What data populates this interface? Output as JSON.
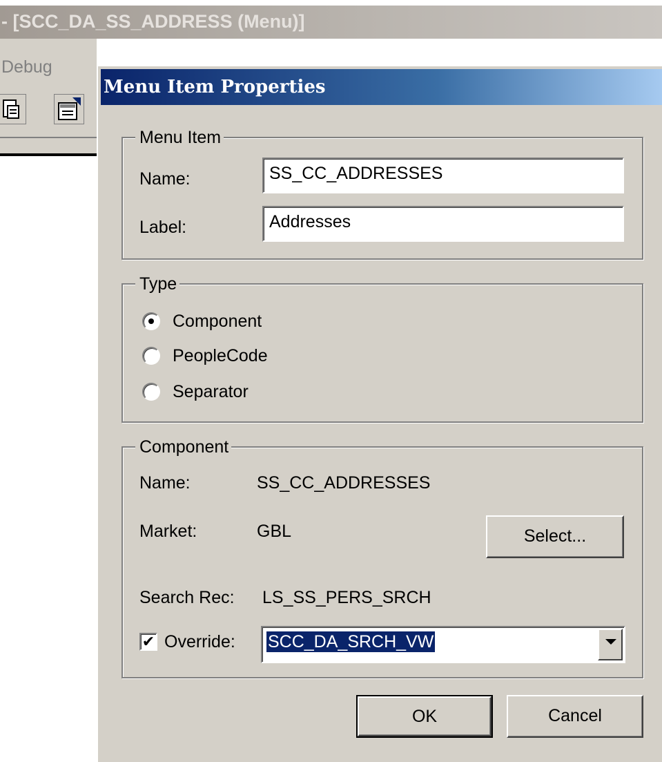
{
  "app": {
    "window_title": "- [SCC_DA_SS_ADDRESS (Menu)]",
    "menu_visible": "Debug"
  },
  "dialog": {
    "title": "Menu Item Properties",
    "menu_item": {
      "legend": "Menu Item",
      "name_label": "Name:",
      "name_value": "SS_CC_ADDRESSES",
      "label_label": "Label:",
      "label_value": "Addresses"
    },
    "type": {
      "legend": "Type",
      "options": [
        {
          "label": "Component",
          "checked": true
        },
        {
          "label": "PeopleCode",
          "checked": false
        },
        {
          "label": "Separator",
          "checked": false
        }
      ]
    },
    "component": {
      "legend": "Component",
      "name_label": "Name:",
      "name_value": "SS_CC_ADDRESSES",
      "market_label": "Market:",
      "market_value": "GBL",
      "select_button": "Select...",
      "search_rec_label": "Search Rec:",
      "search_rec_value": "LS_SS_PERS_SRCH",
      "override_label": "Override:",
      "override_checked": true,
      "override_value": "SCC_DA_SRCH_VW"
    },
    "ok_button": "OK",
    "cancel_button": "Cancel"
  }
}
